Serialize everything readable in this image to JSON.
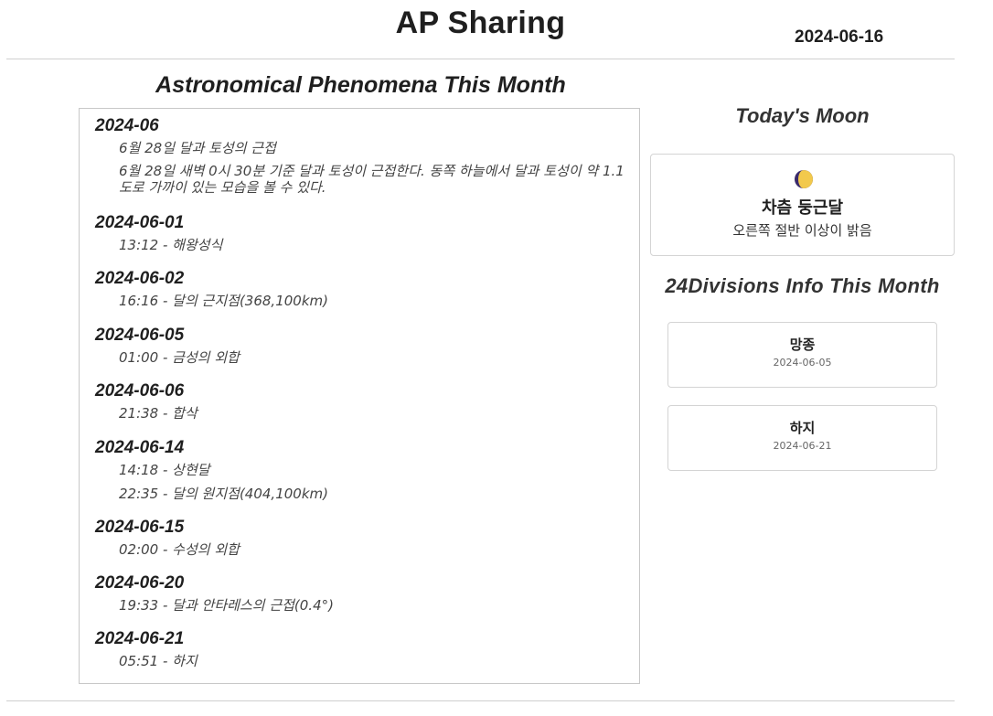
{
  "header": {
    "title": "AP Sharing",
    "date": "2024-06-16"
  },
  "phenomena": {
    "heading": "Astronomical Phenomena This Month",
    "days": [
      {
        "date": "2024-06",
        "events": [
          "6월 28일 달과 토성의 근접",
          "6월 28일 새벽 0시 30분 기준 달과 토성이 근접한다. 동쪽 하늘에서 달과 토성이 약 1.1도로 가까이 있는 모습을 볼 수 있다."
        ]
      },
      {
        "date": "2024-06-01",
        "events": [
          "13:12 - 해왕성식"
        ]
      },
      {
        "date": "2024-06-02",
        "events": [
          "16:16 - 달의 근지점(368,100km)"
        ]
      },
      {
        "date": "2024-06-05",
        "events": [
          "01:00 - 금성의 외합"
        ]
      },
      {
        "date": "2024-06-06",
        "events": [
          "21:38 - 합삭"
        ]
      },
      {
        "date": "2024-06-14",
        "events": [
          "14:18 - 상현달",
          "22:35 - 달의 원지점(404,100km)"
        ]
      },
      {
        "date": "2024-06-15",
        "events": [
          "02:00 - 수성의 외합"
        ]
      },
      {
        "date": "2024-06-20",
        "events": [
          "19:33 - 달과 안타레스의 근접(0.4°)"
        ]
      },
      {
        "date": "2024-06-21",
        "events": [
          "05:51 - 하지"
        ]
      }
    ]
  },
  "moon": {
    "heading": "Today's Moon",
    "icon": "waxing-gibbous-moon-icon",
    "phase": "차츰 둥근달",
    "description": "오른쪽 절반 이상이 밝음",
    "colors": {
      "lit": "#f2c94c",
      "dark": "#3a2a6b"
    }
  },
  "divisions": {
    "heading": "24Divisions Info This Month",
    "items": [
      {
        "name": "망종",
        "date": "2024-06-05"
      },
      {
        "name": "하지",
        "date": "2024-06-21"
      }
    ]
  }
}
